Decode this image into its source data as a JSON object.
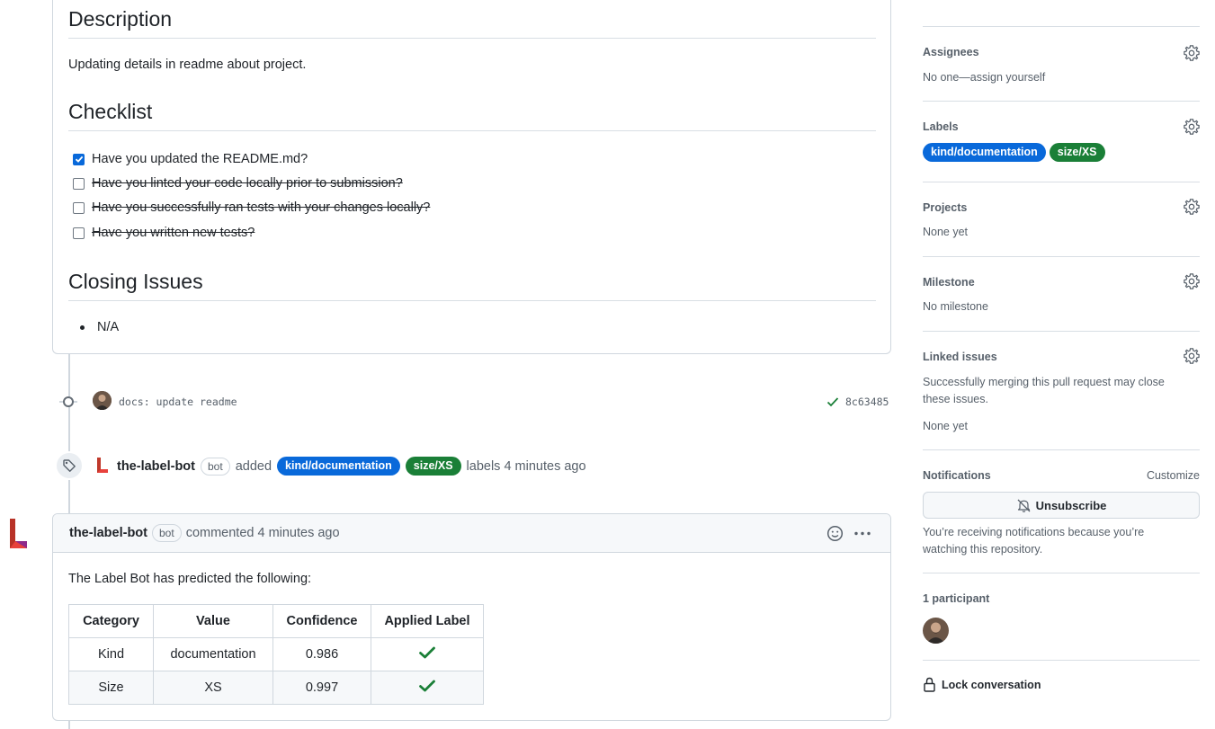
{
  "description": {
    "heading": "Description",
    "text": "Updating details in readme about project."
  },
  "checklist": {
    "heading": "Checklist",
    "items": [
      {
        "label": "Have you updated the README.md?",
        "checked": true,
        "struck": false
      },
      {
        "label": "Have you linted your code locally prior to submission?",
        "checked": false,
        "struck": true
      },
      {
        "label": "Have you successfully ran tests with your changes locally?",
        "checked": false,
        "struck": true
      },
      {
        "label": "Have you written new tests?",
        "checked": false,
        "struck": true
      }
    ]
  },
  "closing": {
    "heading": "Closing Issues",
    "items": [
      "N/A"
    ]
  },
  "commit": {
    "message": "docs: update readme",
    "sha": "8c63485"
  },
  "label_event": {
    "actor": "the-label-bot",
    "bot_badge": "bot",
    "verb": "added",
    "labels": [
      "kind/documentation",
      "size/XS"
    ],
    "suffix": "labels 4 minutes ago"
  },
  "comment": {
    "author": "the-label-bot",
    "bot_badge": "bot",
    "meta": "commented 4 minutes ago",
    "body": "The Label Bot has predicted the following:",
    "table": {
      "headers": [
        "Category",
        "Value",
        "Confidence",
        "Applied Label"
      ],
      "rows": [
        {
          "category": "Kind",
          "value": "documentation",
          "confidence": "0.986",
          "applied": true
        },
        {
          "category": "Size",
          "value": "XS",
          "confidence": "0.997",
          "applied": true
        }
      ]
    }
  },
  "sidebar": {
    "assignees": {
      "title": "Assignees",
      "text": "No one—assign yourself"
    },
    "labels": {
      "title": "Labels",
      "items": [
        "kind/documentation",
        "size/XS"
      ]
    },
    "projects": {
      "title": "Projects",
      "text": "None yet"
    },
    "milestone": {
      "title": "Milestone",
      "text": "No milestone"
    },
    "linked": {
      "title": "Linked issues",
      "text": "Successfully merging this pull request may close these issues.",
      "none": "None yet"
    },
    "notifications": {
      "title": "Notifications",
      "customize": "Customize",
      "button": "Unsubscribe",
      "reason": "You’re receiving notifications because you’re watching this repository."
    },
    "participants": {
      "title": "1 participant"
    },
    "lock": "Lock conversation"
  },
  "colors": {
    "label_blue": "#0969da",
    "label_green": "#1a7f37",
    "checkmark": "#1a7f37",
    "checkbox_checked": "#0969da"
  }
}
